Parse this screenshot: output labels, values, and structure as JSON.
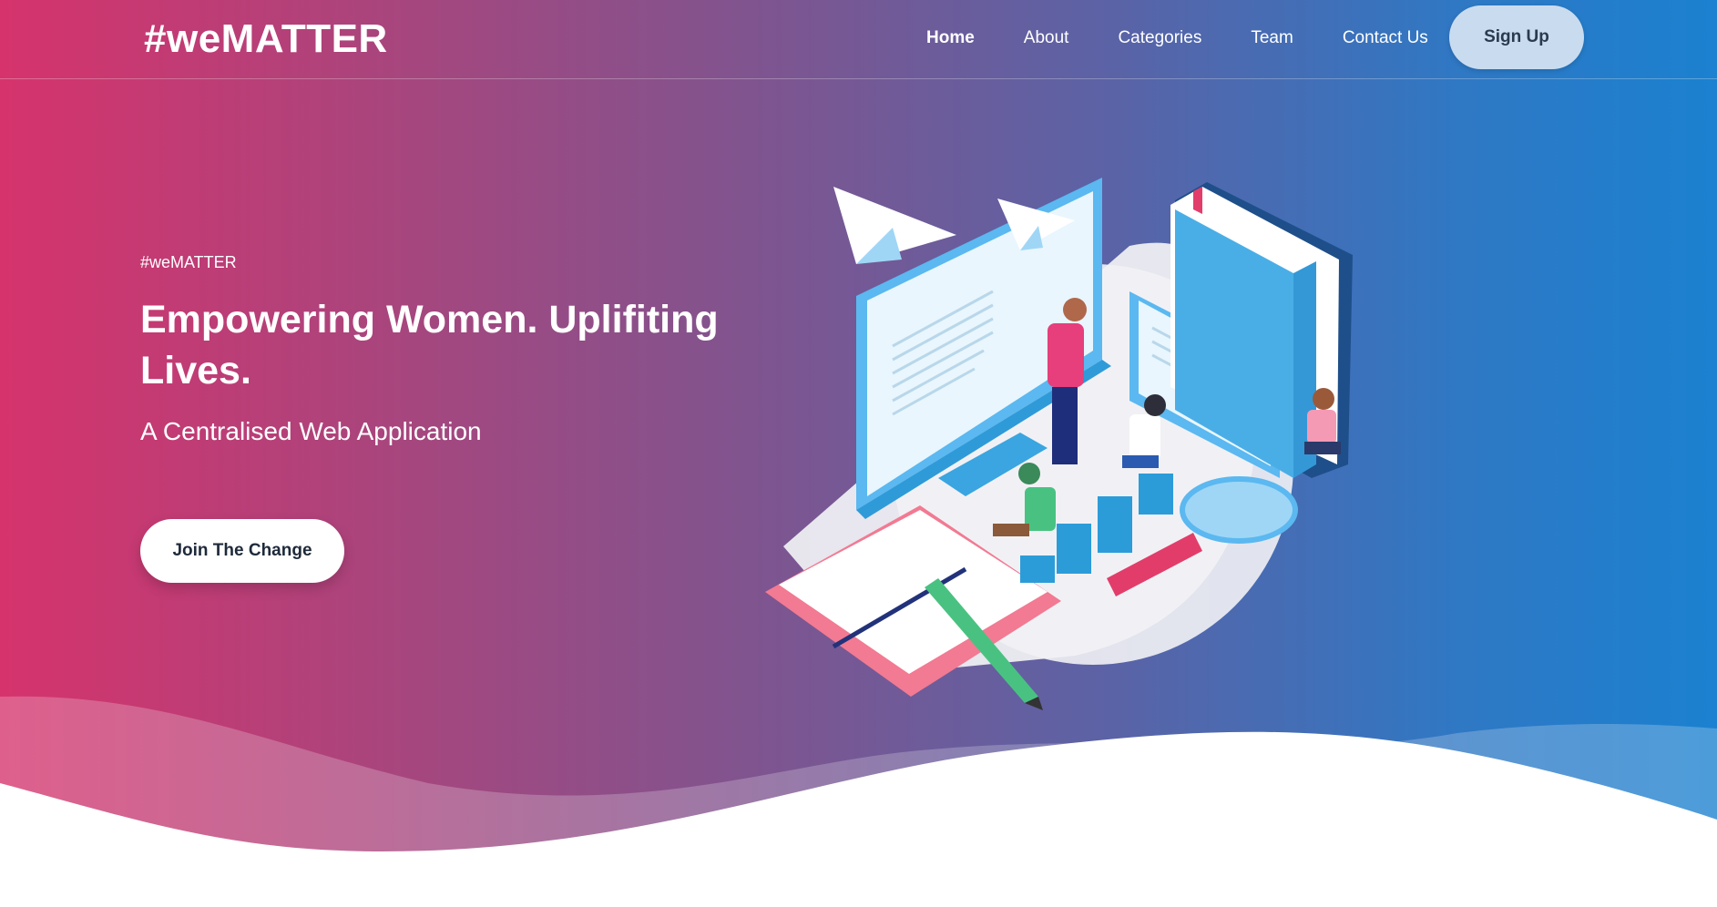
{
  "brand": {
    "logo": "#weMATTER"
  },
  "nav": {
    "items": [
      {
        "label": "Home",
        "active": true
      },
      {
        "label": "About"
      },
      {
        "label": "Categories"
      },
      {
        "label": "Team"
      },
      {
        "label": "Contact Us"
      }
    ],
    "signup_label": "Sign Up"
  },
  "hero": {
    "tagline": "#weMATTER",
    "headline": "Empowering Women. Uplifiting Lives.",
    "subheadline": "A Centralised Web Application",
    "cta_label": "Join The Change"
  },
  "colors": {
    "gradient_start": "#d6336c",
    "gradient_end": "#1b81d0",
    "signup_bg": "#c9dcef",
    "cta_bg": "#ffffff"
  }
}
